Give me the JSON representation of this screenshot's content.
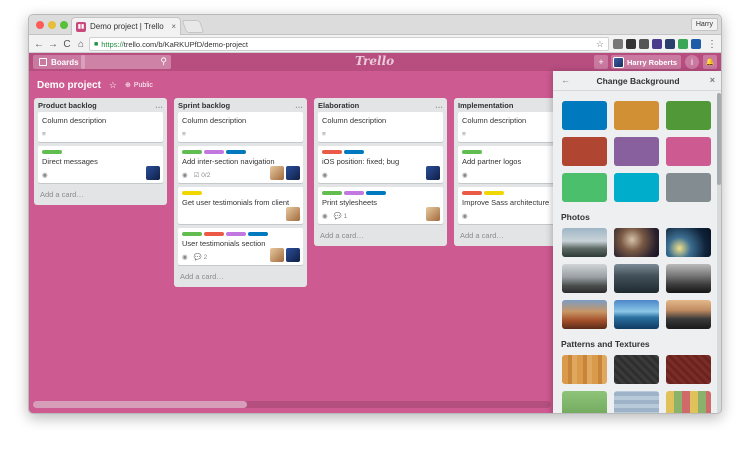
{
  "browser": {
    "tab_title": "Demo project | Trello",
    "tab_close": "×",
    "profile_name": "Harry",
    "url_https": "https://",
    "url_rest": "trello.com/b/KaRKUPfD/demo-project",
    "back_icon": "←",
    "forward_icon": "→",
    "reload_icon": "C",
    "home_icon": "⌂",
    "star_icon": "☆",
    "lock_icon": "🔒",
    "menu_icon": "⋮"
  },
  "header": {
    "boards_label": "Boards",
    "logo": "Trello",
    "add_icon": "+",
    "user_name": "Harry Roberts",
    "info_icon": "i",
    "bell_icon": "🔔",
    "search_icon": "⚲"
  },
  "board": {
    "title": "Demo project",
    "star_icon": "☆",
    "visibility": "Public",
    "visibility_icon": "⊕"
  },
  "lists": [
    {
      "name": "Product backlog",
      "menu": "…",
      "add_card": "Add a card…",
      "cards": [
        {
          "title": "Column description",
          "badges": [
            "≡"
          ]
        },
        {
          "title": "Direct messages",
          "badges": [
            "◉"
          ]
        }
      ]
    },
    {
      "name": "Sprint backlog",
      "menu": "…",
      "add_card": "Add a card…",
      "cards": [
        {
          "title": "Column description",
          "badges": [
            "≡"
          ]
        },
        {
          "title": "Add inter-section navigation",
          "badges": [
            "◉",
            "☑ 0/2"
          ]
        },
        {
          "title": "Get user testimonials from client",
          "badges": []
        },
        {
          "title": "User testimonials section",
          "badges": [
            "◉",
            "💬 2"
          ]
        }
      ]
    },
    {
      "name": "Elaboration",
      "menu": "…",
      "add_card": "Add a card…",
      "cards": [
        {
          "title": "Column description",
          "badges": [
            "≡"
          ]
        },
        {
          "title": "iOS position: fixed; bug",
          "badges": [
            "◉"
          ]
        },
        {
          "title": "Print stylesheets",
          "badges": [
            "◉",
            "💬 1"
          ]
        }
      ]
    },
    {
      "name": "Implementation",
      "menu": "…",
      "add_card": "Add a card…",
      "cards": [
        {
          "title": "Column description",
          "badges": [
            "≡"
          ]
        },
        {
          "title": "Add partner logos",
          "badges": [
            "◉"
          ]
        },
        {
          "title": "Improve Sass architecture",
          "badges": [
            "◉"
          ]
        }
      ]
    }
  ],
  "label_colors": {
    "green": "#61bd4f",
    "purple": "#c377e0",
    "blue": "#0079bf",
    "red": "#eb5a46",
    "yellow": "#f2d600",
    "orange": "#ffab4a"
  },
  "panel": {
    "title": "Change Background",
    "back_icon": "←",
    "close_icon": "×",
    "colors": [
      "#0079bf",
      "#d29034",
      "#519839",
      "#b04632",
      "#89609e",
      "#cd5a91",
      "#4bbf6b",
      "#00aecc",
      "#838c91"
    ],
    "photos_heading": "Photos",
    "patterns_heading": "Patterns and Textures"
  }
}
